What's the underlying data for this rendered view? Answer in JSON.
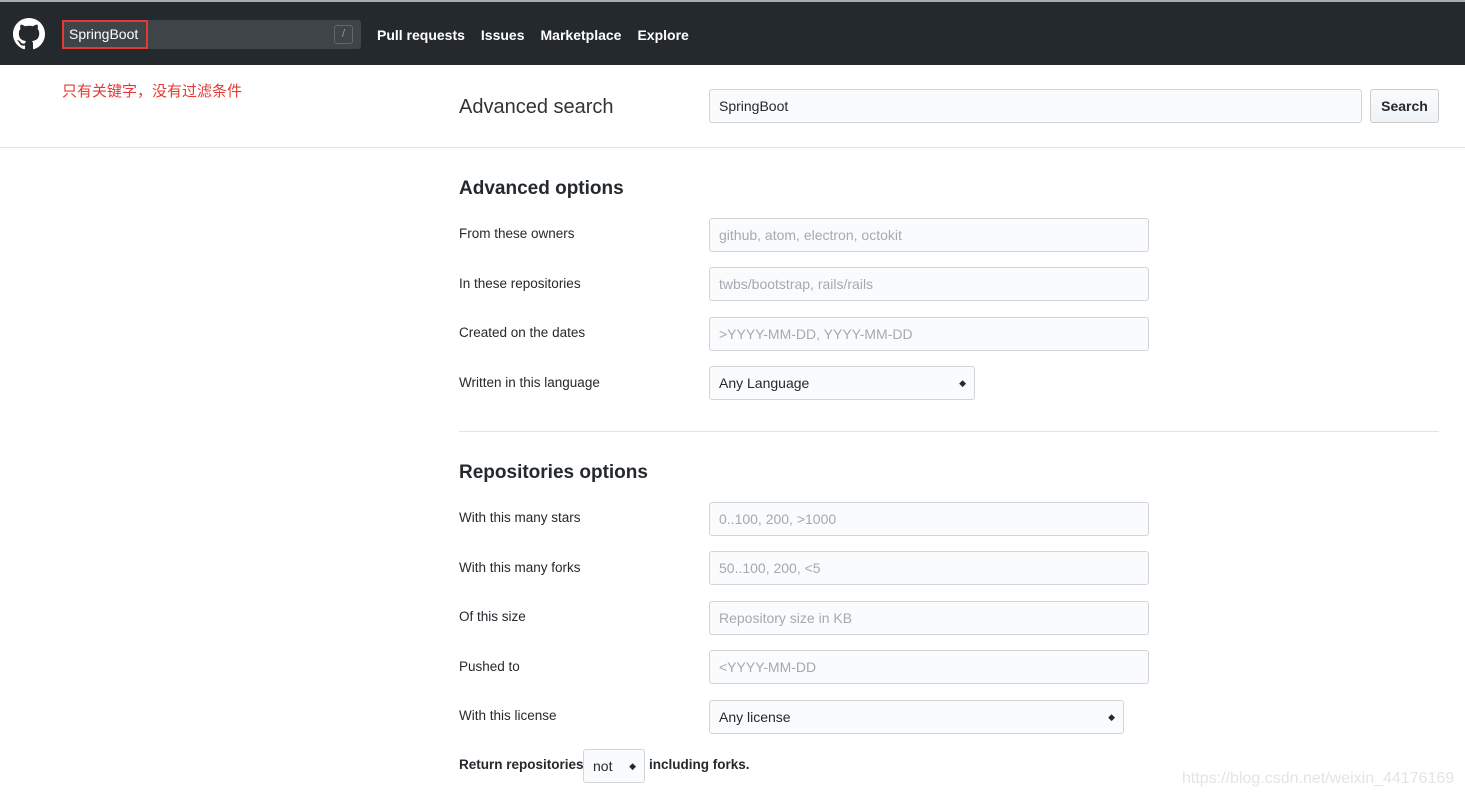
{
  "header": {
    "search_value": "SpringBoot",
    "slash_hint": "/",
    "nav": [
      "Pull requests",
      "Issues",
      "Marketplace",
      "Explore"
    ]
  },
  "annotation": "只有关键字，没有过滤条件",
  "advanced_search": {
    "title": "Advanced search",
    "query": "SpringBoot",
    "search_button": "Search"
  },
  "advanced_options": {
    "heading": "Advanced options",
    "fields": [
      {
        "label": "From these owners",
        "placeholder": "github, atom, electron, octokit"
      },
      {
        "label": "In these repositories",
        "placeholder": "twbs/bootstrap, rails/rails"
      },
      {
        "label": "Created on the dates",
        "placeholder": ">YYYY-MM-DD, YYYY-MM-DD"
      }
    ],
    "language": {
      "label": "Written in this language",
      "value": "Any Language"
    }
  },
  "repositories_options": {
    "heading": "Repositories options",
    "fields": [
      {
        "label": "With this many stars",
        "placeholder": "0..100, 200, >1000"
      },
      {
        "label": "With this many forks",
        "placeholder": "50..100, 200, <5"
      },
      {
        "label": "Of this size",
        "placeholder": "Repository size in KB"
      },
      {
        "label": "Pushed to",
        "placeholder": "<YYYY-MM-DD"
      }
    ],
    "license": {
      "label": "With this license",
      "value": "Any license"
    },
    "forks": {
      "prefix": "Return repositories",
      "value": "not",
      "suffix": "including forks."
    }
  },
  "watermark": "https://blog.csdn.net/weixin_44176169"
}
